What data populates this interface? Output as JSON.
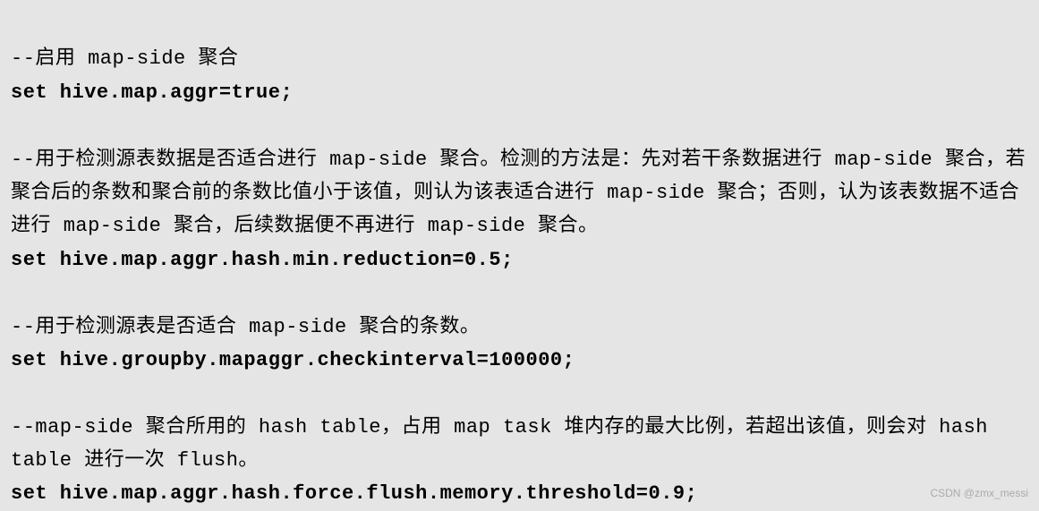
{
  "lines": {
    "c1": "--启用 map-side 聚合",
    "s1": "set hive.map.aggr=true;",
    "c2": "--用于检测源表数据是否适合进行 map-side 聚合。检测的方法是：先对若干条数据进行 map-side 聚合，若聚合后的条数和聚合前的条数比值小于该值，则认为该表适合进行 map-side 聚合；否则，认为该表数据不适合进行 map-side 聚合，后续数据便不再进行 map-side 聚合。",
    "s2": "set hive.map.aggr.hash.min.reduction=0.5;",
    "c3": "--用于检测源表是否适合 map-side 聚合的条数。",
    "s3": "set hive.groupby.mapaggr.checkinterval=100000;",
    "c4": "--map-side 聚合所用的 hash table，占用 map task 堆内存的最大比例，若超出该值，则会对 hash table 进行一次 flush。",
    "s4": "set hive.map.aggr.hash.force.flush.memory.threshold=0.9;"
  },
  "watermark": "CSDN @zmx_messi"
}
